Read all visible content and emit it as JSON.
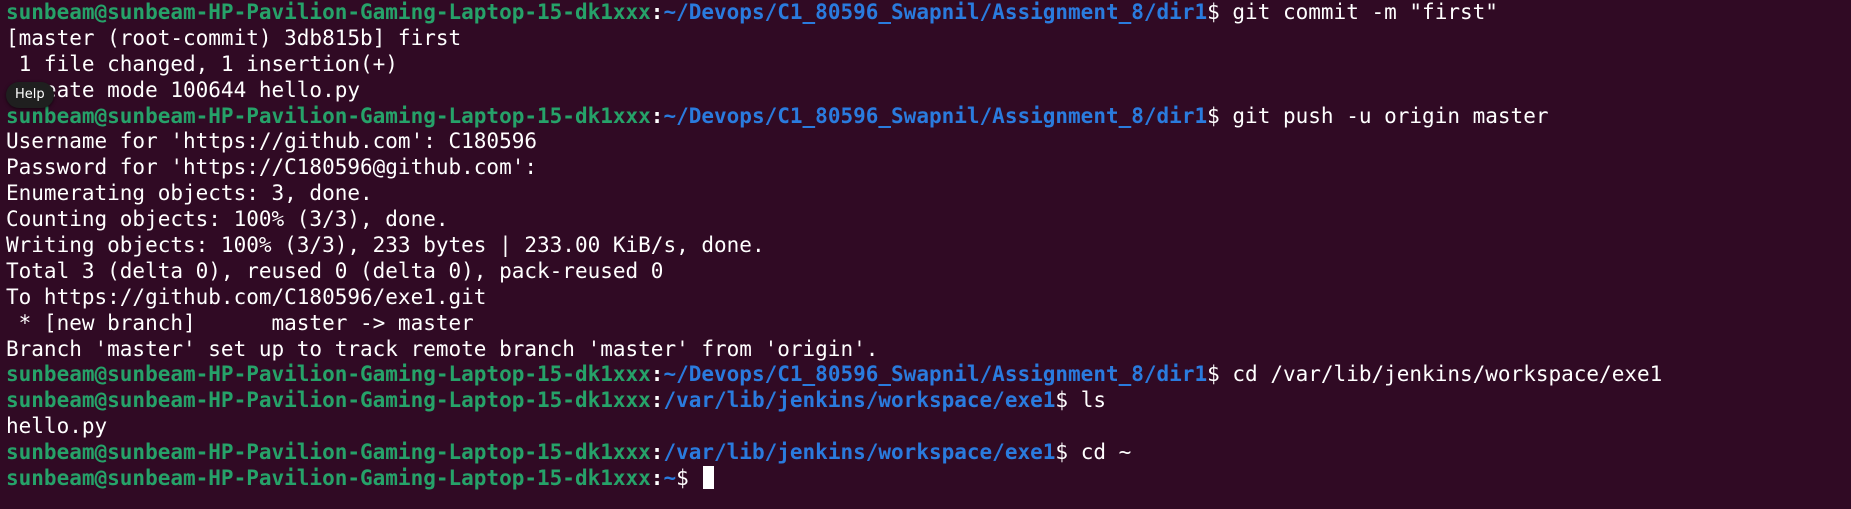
{
  "terminal": {
    "prompt_user": "sunbeam@sunbeam-HP-Pavilion-Gaming-Laptop-15-dk1xxx",
    "lines": [
      {
        "kind": "prompt",
        "path": "~/Devops/C1_80596_Swapnil/Assignment_8/dir1",
        "command": "git commit -m \"first\""
      },
      {
        "kind": "output",
        "text": "[master (root-commit) 3db815b] first"
      },
      {
        "kind": "output",
        "text": " 1 file changed, 1 insertion(+)"
      },
      {
        "kind": "output",
        "text": " create mode 100644 hello.py"
      },
      {
        "kind": "prompt",
        "path": "~/Devops/C1_80596_Swapnil/Assignment_8/dir1",
        "command": "git push -u origin master"
      },
      {
        "kind": "output",
        "text": "Username for 'https://github.com': C180596"
      },
      {
        "kind": "output",
        "text": "Password for 'https://C180596@github.com':"
      },
      {
        "kind": "output",
        "text": "Enumerating objects: 3, done."
      },
      {
        "kind": "output",
        "text": "Counting objects: 100% (3/3), done."
      },
      {
        "kind": "output",
        "text": "Writing objects: 100% (3/3), 233 bytes | 233.00 KiB/s, done."
      },
      {
        "kind": "output",
        "text": "Total 3 (delta 0), reused 0 (delta 0), pack-reused 0"
      },
      {
        "kind": "output",
        "text": "To https://github.com/C180596/exe1.git"
      },
      {
        "kind": "output",
        "text": " * [new branch]      master -> master"
      },
      {
        "kind": "output",
        "text": "Branch 'master' set up to track remote branch 'master' from 'origin'."
      },
      {
        "kind": "prompt",
        "path": "~/Devops/C1_80596_Swapnil/Assignment_8/dir1",
        "command": "cd /var/lib/jenkins/workspace/exe1"
      },
      {
        "kind": "prompt",
        "path": "/var/lib/jenkins/workspace/exe1",
        "command": "ls"
      },
      {
        "kind": "output",
        "text": "hello.py"
      },
      {
        "kind": "prompt",
        "path": "/var/lib/jenkins/workspace/exe1",
        "command": "cd ~"
      },
      {
        "kind": "prompt",
        "path": "~",
        "command": "",
        "active": true
      }
    ]
  },
  "tooltip": {
    "label": "Help"
  },
  "colors": {
    "background": "#300a24",
    "user": "#26a269",
    "path": "#2a7bde",
    "text": "#ffffff"
  }
}
